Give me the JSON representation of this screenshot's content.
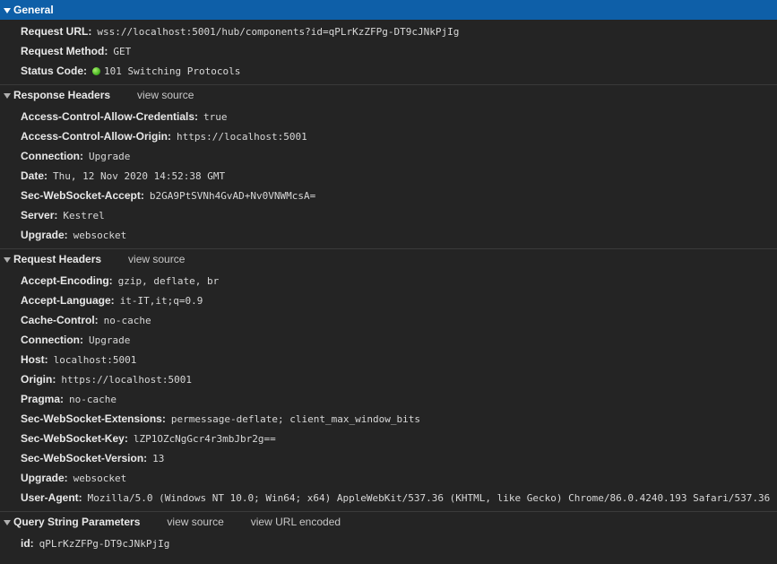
{
  "general": {
    "title": "General",
    "request_url": {
      "name": "Request URL:",
      "value": "wss://localhost:5001/hub/components?id=qPLrKzZFPg-DT9cJNkPjIg"
    },
    "request_method": {
      "name": "Request Method:",
      "value": "GET"
    },
    "status_code": {
      "name": "Status Code:",
      "value": "101 Switching Protocols",
      "status_color": "#3fae1c"
    }
  },
  "response_headers": {
    "title": "Response Headers",
    "view_source": "view source",
    "items": [
      {
        "name": "Access-Control-Allow-Credentials:",
        "value": "true"
      },
      {
        "name": "Access-Control-Allow-Origin:",
        "value": "https://localhost:5001"
      },
      {
        "name": "Connection:",
        "value": "Upgrade"
      },
      {
        "name": "Date:",
        "value": "Thu, 12 Nov 2020 14:52:38 GMT"
      },
      {
        "name": "Sec-WebSocket-Accept:",
        "value": "b2GA9PtSVNh4GvAD+Nv0VNWMcsA="
      },
      {
        "name": "Server:",
        "value": "Kestrel"
      },
      {
        "name": "Upgrade:",
        "value": "websocket"
      }
    ]
  },
  "request_headers": {
    "title": "Request Headers",
    "view_source": "view source",
    "items": [
      {
        "name": "Accept-Encoding:",
        "value": "gzip, deflate, br"
      },
      {
        "name": "Accept-Language:",
        "value": "it-IT,it;q=0.9"
      },
      {
        "name": "Cache-Control:",
        "value": "no-cache"
      },
      {
        "name": "Connection:",
        "value": "Upgrade"
      },
      {
        "name": "Host:",
        "value": "localhost:5001"
      },
      {
        "name": "Origin:",
        "value": "https://localhost:5001"
      },
      {
        "name": "Pragma:",
        "value": "no-cache"
      },
      {
        "name": "Sec-WebSocket-Extensions:",
        "value": "permessage-deflate; client_max_window_bits"
      },
      {
        "name": "Sec-WebSocket-Key:",
        "value": "lZP1OZcNgGcr4r3mbJbr2g=="
      },
      {
        "name": "Sec-WebSocket-Version:",
        "value": "13"
      },
      {
        "name": "Upgrade:",
        "value": "websocket"
      },
      {
        "name": "User-Agent:",
        "value": "Mozilla/5.0 (Windows NT 10.0; Win64; x64) AppleWebKit/537.36 (KHTML, like Gecko) Chrome/86.0.4240.193 Safari/537.36"
      }
    ]
  },
  "query_params": {
    "title": "Query String Parameters",
    "view_source": "view source",
    "view_url_encoded": "view URL encoded",
    "items": [
      {
        "name": "id:",
        "value": "qPLrKzZFPg-DT9cJNkPjIg"
      }
    ]
  },
  "colors": {
    "background": "#242424",
    "selected_header": "#0e5fa8",
    "status_ok": "#3fae1c"
  }
}
